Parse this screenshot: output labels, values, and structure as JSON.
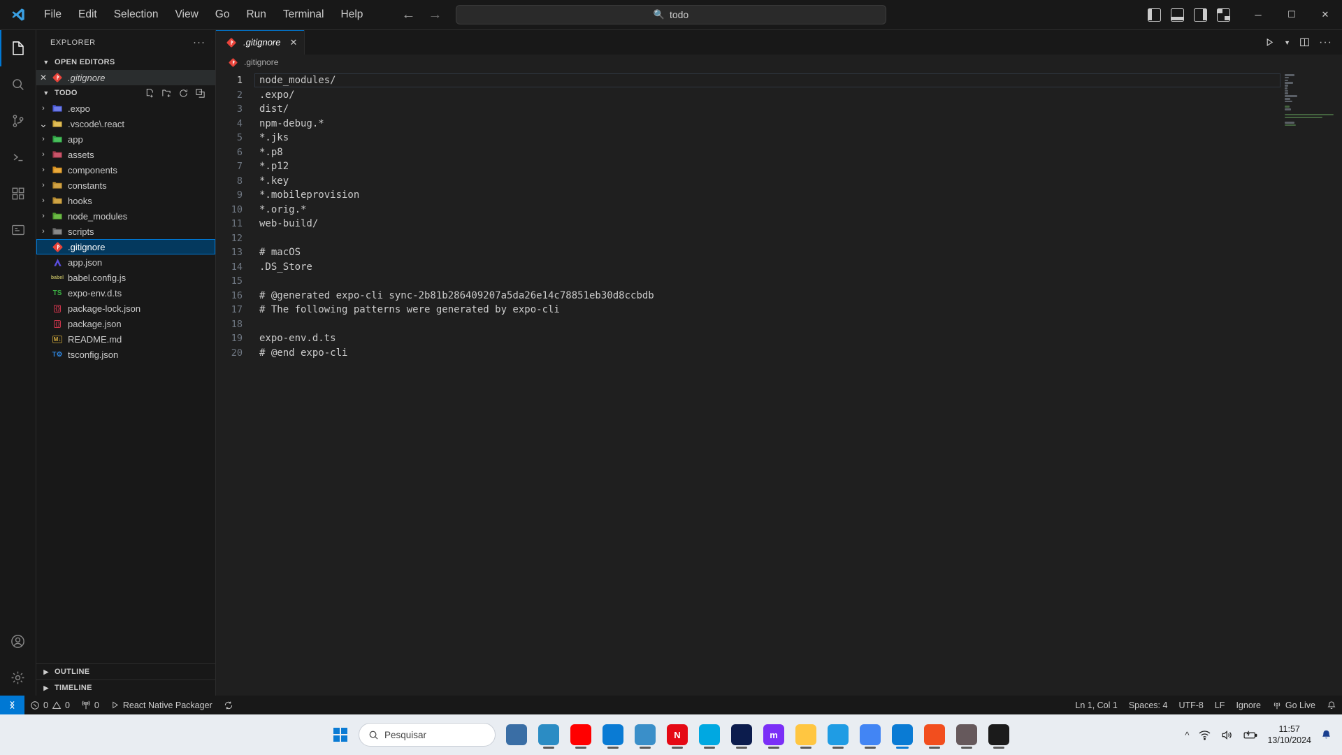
{
  "titlebar": {
    "logo_icon": "vscode-logo-icon",
    "menus": [
      "File",
      "Edit",
      "Selection",
      "View",
      "Go",
      "Run",
      "Terminal",
      "Help"
    ],
    "nav_back_icon": "arrow-left-icon",
    "nav_forward_icon": "arrow-right-icon",
    "command_center": {
      "search_icon": "search-icon",
      "text": "todo"
    },
    "layout_icons": [
      "toggle-primary-sidebar-icon",
      "toggle-panel-icon",
      "toggle-secondary-sidebar-icon",
      "customize-layout-icon"
    ],
    "window_controls": {
      "minimize": "─",
      "maximize": "☐",
      "close": "✕"
    }
  },
  "activitybar": {
    "items": [
      {
        "name": "explorer",
        "icon": "files-icon",
        "active": true,
        "badge": ""
      },
      {
        "name": "search",
        "icon": "search-icon",
        "active": false,
        "badge": ""
      },
      {
        "name": "source-control",
        "icon": "source-control-icon",
        "active": false,
        "badge": ""
      },
      {
        "name": "run-and-debug",
        "icon": "debug-icon",
        "active": false,
        "badge": ""
      },
      {
        "name": "extensions",
        "icon": "extensions-icon",
        "active": false,
        "badge": ""
      },
      {
        "name": "remote-explorer",
        "icon": "remote-explorer-icon",
        "active": false,
        "badge": ""
      }
    ],
    "bottom": [
      {
        "name": "accounts",
        "icon": "account-icon"
      },
      {
        "name": "manage",
        "icon": "gear-icon"
      }
    ]
  },
  "sidebar": {
    "title": "EXPLORER",
    "more_actions": "···",
    "open_editors": {
      "label": "OPEN EDITORS",
      "items": [
        {
          "close": "✕",
          "icon": "git-file-icon",
          "label": ".gitignore",
          "selected": true
        }
      ]
    },
    "folder": {
      "label": "TODO",
      "actions": [
        "new-file-icon",
        "new-folder-icon",
        "refresh-icon",
        "collapse-all-icon"
      ],
      "items": [
        {
          "label": ".expo",
          "type": "folder",
          "icon": "expo-folder-icon",
          "arrow": "›",
          "indent": 0
        },
        {
          "label": ".vscode\\.react",
          "type": "folder",
          "icon": "vscode-folder-icon",
          "arrow": "⌄",
          "indent": 0
        },
        {
          "label": "app",
          "type": "folder",
          "icon": "app-folder-icon",
          "arrow": "›",
          "indent": 0
        },
        {
          "label": "assets",
          "type": "folder",
          "icon": "assets-folder-icon",
          "arrow": "›",
          "indent": 0
        },
        {
          "label": "components",
          "type": "folder",
          "icon": "components-folder-icon",
          "arrow": "›",
          "indent": 0
        },
        {
          "label": "constants",
          "type": "folder",
          "icon": "constants-folder-icon",
          "arrow": "›",
          "indent": 0
        },
        {
          "label": "hooks",
          "type": "folder",
          "icon": "hooks-folder-icon",
          "arrow": "›",
          "indent": 0
        },
        {
          "label": "node_modules",
          "type": "folder",
          "icon": "node-folder-icon",
          "arrow": "›",
          "indent": 0
        },
        {
          "label": "scripts",
          "type": "folder",
          "icon": "scripts-folder-icon",
          "arrow": "›",
          "indent": 0
        },
        {
          "label": ".gitignore",
          "type": "file",
          "icon": "git-file-icon",
          "selected": true
        },
        {
          "label": "app.json",
          "type": "file",
          "icon": "expo-file-icon"
        },
        {
          "label": "babel.config.js",
          "type": "file",
          "icon": "babel-file-icon"
        },
        {
          "label": "expo-env.d.ts",
          "type": "file",
          "icon": "typescript-file-icon"
        },
        {
          "label": "package-lock.json",
          "type": "file",
          "icon": "json-file-icon"
        },
        {
          "label": "package.json",
          "type": "file",
          "icon": "json-file-icon"
        },
        {
          "label": "README.md",
          "type": "file",
          "icon": "markdown-file-icon"
        },
        {
          "label": "tsconfig.json",
          "type": "file",
          "icon": "tsconfig-file-icon"
        }
      ]
    },
    "outline": {
      "label": "OUTLINE",
      "arrow": "›"
    },
    "timeline": {
      "label": "TIMELINE",
      "arrow": "›"
    }
  },
  "editor": {
    "tab": {
      "icon": "git-file-icon",
      "label": ".gitignore",
      "close": "✕"
    },
    "actions": [
      "run-icon",
      "chevron-down-icon",
      "split-editor-icon",
      "more-actions-icon"
    ],
    "breadcrumb": {
      "icon": "git-file-icon",
      "label": ".gitignore"
    },
    "lines": [
      {
        "n": 1,
        "text": "node_modules/",
        "comment": false
      },
      {
        "n": 2,
        "text": ".expo/",
        "comment": false
      },
      {
        "n": 3,
        "text": "dist/",
        "comment": false
      },
      {
        "n": 4,
        "text": "npm-debug.*",
        "comment": false
      },
      {
        "n": 5,
        "text": "*.jks",
        "comment": false
      },
      {
        "n": 6,
        "text": "*.p8",
        "comment": false
      },
      {
        "n": 7,
        "text": "*.p12",
        "comment": false
      },
      {
        "n": 8,
        "text": "*.key",
        "comment": false
      },
      {
        "n": 9,
        "text": "*.mobileprovision",
        "comment": false
      },
      {
        "n": 10,
        "text": "*.orig.*",
        "comment": false
      },
      {
        "n": 11,
        "text": "web-build/",
        "comment": false
      },
      {
        "n": 12,
        "text": "",
        "comment": false
      },
      {
        "n": 13,
        "text": "# macOS",
        "comment": true
      },
      {
        "n": 14,
        "text": ".DS_Store",
        "comment": false
      },
      {
        "n": 15,
        "text": "",
        "comment": false
      },
      {
        "n": 16,
        "text": "# @generated expo-cli sync-2b81b286409207a5da26e14c78851eb30d8ccbdb",
        "comment": true
      },
      {
        "n": 17,
        "text": "# The following patterns were generated by expo-cli",
        "comment": true
      },
      {
        "n": 18,
        "text": "",
        "comment": false
      },
      {
        "n": 19,
        "text": "expo-env.d.ts",
        "comment": false
      },
      {
        "n": 20,
        "text": "# @end expo-cli",
        "comment": true
      }
    ]
  },
  "statusbar": {
    "remote_icon": "remote-window-icon",
    "left": [
      {
        "name": "problems",
        "icon": "error-icon",
        "errors": "0",
        "warn_icon": "warning-icon",
        "warnings": "0"
      },
      {
        "name": "ports",
        "icon": "radio-tower-icon",
        "text": "0"
      },
      {
        "name": "react-native-packager",
        "icon": "play-icon",
        "text": "React Native Packager"
      },
      {
        "name": "sync",
        "icon": "sync-icon",
        "text": ""
      }
    ],
    "right": [
      {
        "name": "editor-position",
        "text": "Ln 1, Col 1"
      },
      {
        "name": "indentation",
        "text": "Spaces: 4"
      },
      {
        "name": "encoding",
        "text": "UTF-8"
      },
      {
        "name": "eol",
        "text": "LF"
      },
      {
        "name": "language-mode",
        "text": "Ignore"
      },
      {
        "name": "go-live",
        "icon": "broadcast-icon",
        "text": "Go Live"
      },
      {
        "name": "notifications",
        "icon": "bell-icon",
        "text": ""
      }
    ]
  },
  "taskbar": {
    "start_icon": "windows-start-icon",
    "search": {
      "icon": "search-icon",
      "placeholder": "Pesquisar"
    },
    "apps": [
      {
        "name": "task-view",
        "label": "",
        "color": "#3a6ea5"
      },
      {
        "name": "edge-copilot",
        "label": "",
        "color": "#2b8cc4"
      },
      {
        "name": "youtube",
        "label": "",
        "color": "#ff0000"
      },
      {
        "name": "microsoft-store",
        "label": "",
        "color": "#0a7bd4"
      },
      {
        "name": "photos",
        "label": "",
        "color": "#3a8fc9"
      },
      {
        "name": "netflix",
        "label": "N",
        "color": "#e50914"
      },
      {
        "name": "prime-video",
        "label": "",
        "color": "#00a8e1"
      },
      {
        "name": "disney-plus",
        "label": "",
        "color": "#0c1c4d"
      },
      {
        "name": "max",
        "label": "m",
        "color": "#7b2ff7"
      },
      {
        "name": "file-explorer",
        "label": "",
        "color": "#ffc641"
      },
      {
        "name": "microsoft-edge",
        "label": "",
        "color": "#1f9ce4"
      },
      {
        "name": "google-chrome",
        "label": "",
        "color": "#4285f4"
      },
      {
        "name": "visual-studio-code",
        "label": "",
        "color": "#0a7bd4",
        "active": true
      },
      {
        "name": "figma",
        "label": "",
        "color": "#f24e1e"
      },
      {
        "name": "atom",
        "label": "",
        "color": "#66595c"
      },
      {
        "name": "terminal",
        "label": "",
        "color": "#1b1b1b"
      }
    ],
    "tray": {
      "chevron_icon": "chevron-up-icon",
      "wifi_icon": "wifi-icon",
      "volume_icon": "speaker-icon",
      "battery_icon": "battery-charging-icon",
      "time": "11:57",
      "date": "13/10/2024",
      "notification_icon": "bell-icon"
    }
  },
  "colors": {
    "accent": "#0078d4",
    "selection": "#04395e",
    "comment": "#6a9955",
    "background": "#1f1f1f",
    "chrome": "#181818"
  }
}
